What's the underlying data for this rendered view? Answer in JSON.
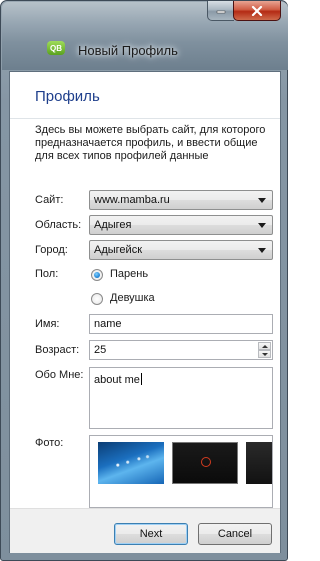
{
  "window": {
    "title": "Новый Профиль",
    "app_icon_text": "QB",
    "icons": {
      "minimize": "minimize-icon",
      "close": "close-icon"
    }
  },
  "page": {
    "title": "Профиль",
    "description": "Здесь вы можете выбрать сайт, для которого предназначается профиль, и ввести общие для всех типов профилей данные"
  },
  "form": {
    "site": {
      "label": "Сайт:",
      "value": "www.mamba.ru"
    },
    "region": {
      "label": "Область:",
      "value": "Адыгея"
    },
    "city": {
      "label": "Город:",
      "value": "Адыгейск"
    },
    "gender": {
      "label": "Пол:",
      "options": [
        "Парень",
        "Девушка"
      ],
      "selected": "Парень"
    },
    "name": {
      "label": "Имя:",
      "value": "name"
    },
    "age": {
      "label": "Возраст:",
      "value": "25"
    },
    "about": {
      "label": "Обо Мне:",
      "value": "about me"
    },
    "photo": {
      "label": "Фото:"
    }
  },
  "buttons": {
    "next": "Next",
    "cancel": "Cancel"
  },
  "colors": {
    "title_blue": "#1f3f8c",
    "close_red": "#c23b22",
    "radio_blue": "#1c7fd2"
  }
}
